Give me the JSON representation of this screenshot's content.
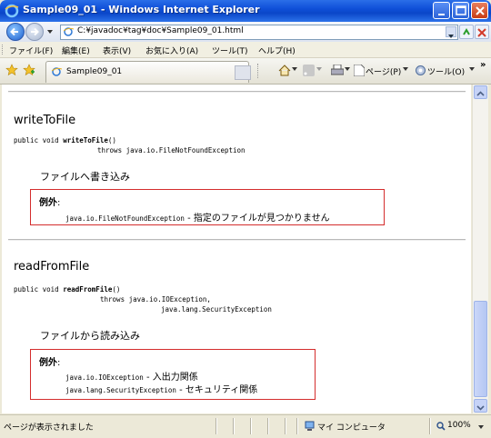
{
  "window": {
    "title": "Sample09_01 - Windows Internet Explorer"
  },
  "address_bar": {
    "url": "C:¥javadoc¥tag¥doc¥Sample09_01.html"
  },
  "menu": {
    "items": [
      "ファイル(F)",
      "編集(E)",
      "表示(V)",
      "お気に入り(A)",
      "ツール(T)",
      "ヘルプ(H)"
    ]
  },
  "tabs": {
    "active_label": "Sample09_01"
  },
  "toolbar": {
    "page_label": "ページ(P)",
    "tools_label": "ツール(O)",
    "overflow": "»"
  },
  "methods": [
    {
      "name": "writeToFile",
      "signature_prefix": "public void ",
      "signature_name": "writeToFile",
      "signature_suffix": "()",
      "throws_lines": [
        "throws java.io.FileNotFoundException"
      ],
      "description": "ファイルへ書き込み",
      "exception_heading": "例外",
      "exceptions": [
        {
          "code": "java.io.FileNotFoundException",
          "text": " - 指定のファイルが見つかりません"
        }
      ]
    },
    {
      "name": "readFromFile",
      "signature_prefix": "public void ",
      "signature_name": "readFromFile",
      "signature_suffix": "()",
      "throws_lines": [
        "throws java.io.IOException,",
        "java.lang.SecurityException"
      ],
      "description": "ファイルから読み込み",
      "exception_heading": "例外",
      "exceptions": [
        {
          "code": "java.io.IOException",
          "text": " - 入出力関係"
        },
        {
          "code": "java.lang.SecurityException",
          "text": " - セキュリティ関係"
        }
      ]
    }
  ],
  "status_bar": {
    "text": "ページが表示されました",
    "zone": "マイ コンピュータ",
    "zoom": "100%"
  }
}
